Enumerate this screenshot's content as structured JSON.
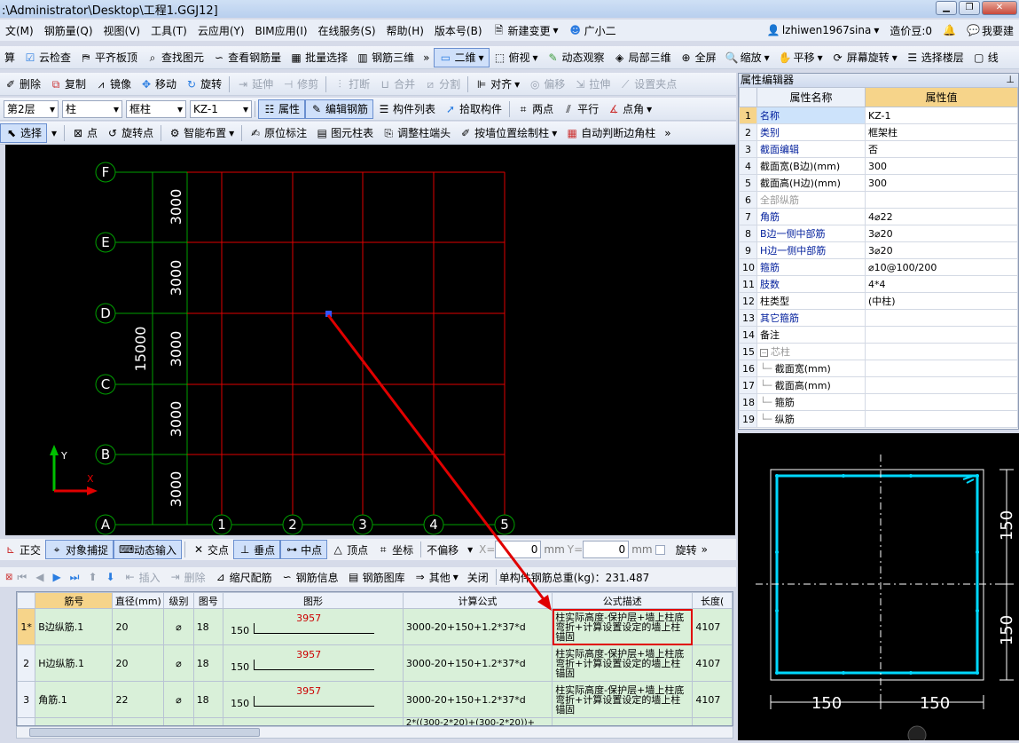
{
  "titlebar": {
    "title": ":\\Administrator\\Desktop\\工程1.GGJ12]"
  },
  "menu": [
    "文(M)",
    "钢筋量(Q)",
    "视图(V)",
    "工具(T)",
    "云应用(Y)",
    "BIM应用(I)",
    "在线服务(S)",
    "帮助(H)",
    "版本号(B)",
    "新建变更",
    "广小二"
  ],
  "account": {
    "user": "lzhiwen1967sina",
    "points": "造价豆:0",
    "help": "我要建"
  },
  "toolbar1": [
    "算",
    "云检查",
    "平齐板顶",
    "查找图元",
    "查看钢筋量",
    "批量选择",
    "钢筋三维",
    "二维",
    "俯视",
    "动态观察",
    "局部三维",
    "全屏",
    "缩放",
    "平移",
    "屏幕旋转",
    "选择楼层",
    "线"
  ],
  "toolbar2": [
    "删除",
    "复制",
    "镜像",
    "移动",
    "旋转",
    "延伸",
    "修剪",
    "打断",
    "合并",
    "分割",
    "对齐",
    "偏移",
    "拉伸",
    "设置夹点"
  ],
  "toolbar3": {
    "floor": "第2层",
    "category": "柱",
    "subcategory": "框柱",
    "component": "KZ-1",
    "buttons": [
      "属性",
      "编辑钢筋",
      "构件列表",
      "拾取构件",
      "两点",
      "平行",
      "点角"
    ]
  },
  "toolbar4": [
    "选择",
    "点",
    "旋转点",
    "智能布置",
    "原位标注",
    "图元柱表",
    "调整柱端头",
    "按墙位置绘制柱",
    "自动判断边角柱"
  ],
  "canvas": {
    "row_labels": [
      "F",
      "E",
      "D",
      "C",
      "B",
      "A"
    ],
    "col_labels": [
      "1",
      "2",
      "3",
      "4",
      "5"
    ],
    "dim_labels": [
      "3000",
      "3000",
      "3000",
      "3000",
      "3000"
    ],
    "total_dim": "15000",
    "axis_y": "Y",
    "axis_x": "X"
  },
  "statusbar": {
    "items": [
      "正交",
      "对象捕捉",
      "动态输入",
      "交点",
      "垂点",
      "中点",
      "顶点",
      "坐标",
      "不偏移"
    ],
    "x_label": "X=",
    "x_value": "0",
    "unit_x": "mm",
    "y_label": "Y=",
    "y_value": "0",
    "unit_y": "mm",
    "rotate": "旋转"
  },
  "rebarbar": {
    "items": [
      "插入",
      "删除",
      "缩尺配筋",
      "钢筋信息",
      "钢筋图库",
      "其他",
      "关闭"
    ],
    "total": "单构件钢筋总重(kg)：231.487"
  },
  "rebar_table": {
    "headers": [
      "",
      "筋号",
      "直径(mm)",
      "级别",
      "图号",
      "图形",
      "计算公式",
      "公式描述",
      "长度("
    ],
    "rows": [
      {
        "rn": "1*",
        "name": "B边纵筋.1",
        "dia": "20",
        "grade": "⌀",
        "fig": "18",
        "hook": "150",
        "len": "3957",
        "formula": "3000-20+150+1.2*37*d",
        "desc": "柱实际高度-保护层+墙上柱底弯折+计算设置设定的墙上柱锚固",
        "total": "4107"
      },
      {
        "rn": "2",
        "name": "H边纵筋.1",
        "dia": "20",
        "grade": "⌀",
        "fig": "18",
        "hook": "150",
        "len": "3957",
        "formula": "3000-20+150+1.2*37*d",
        "desc": "柱实际高度-保护层+墙上柱底弯折+计算设置设定的墙上柱锚固",
        "total": "4107"
      },
      {
        "rn": "3",
        "name": "角筋.1",
        "dia": "22",
        "grade": "⌀",
        "fig": "18",
        "hook": "150",
        "len": "3957",
        "formula": "3000-20+150+1.2*37*d",
        "desc": "柱实际高度-保护层+墙上柱底弯折+计算设置设定的墙上柱锚固",
        "total": "4107"
      }
    ],
    "partial_formula": "2*((300-2*20)+(300-2*20))+"
  },
  "property_panel": {
    "title": "属性编辑器",
    "col_name": "属性名称",
    "col_value": "属性值",
    "rows": [
      {
        "n": "1",
        "name": "名称",
        "value": "KZ-1",
        "style": "blue"
      },
      {
        "n": "2",
        "name": "类别",
        "value": "框架柱",
        "style": "blue"
      },
      {
        "n": "3",
        "name": "截面编辑",
        "value": "否",
        "style": "blue"
      },
      {
        "n": "4",
        "name": "截面宽(B边)(mm)",
        "value": "300",
        "style": ""
      },
      {
        "n": "5",
        "name": "截面高(H边)(mm)",
        "value": "300",
        "style": ""
      },
      {
        "n": "6",
        "name": "全部纵筋",
        "value": "",
        "style": "grey"
      },
      {
        "n": "7",
        "name": "角筋",
        "value": "4⌀22",
        "style": "blue"
      },
      {
        "n": "8",
        "name": "B边一侧中部筋",
        "value": "3⌀20",
        "style": "blue"
      },
      {
        "n": "9",
        "name": "H边一侧中部筋",
        "value": "3⌀20",
        "style": "blue"
      },
      {
        "n": "10",
        "name": "箍筋",
        "value": "⌀10@100/200",
        "style": "blue"
      },
      {
        "n": "11",
        "name": "肢数",
        "value": "4*4",
        "style": "blue"
      },
      {
        "n": "12",
        "name": "柱类型",
        "value": "(中柱)",
        "style": ""
      },
      {
        "n": "13",
        "name": "其它箍筋",
        "value": "",
        "style": "blue"
      },
      {
        "n": "14",
        "name": "备注",
        "value": "",
        "style": ""
      },
      {
        "n": "15",
        "name": "芯柱",
        "value": "",
        "style": "grey"
      },
      {
        "n": "16",
        "name": "截面宽(mm)",
        "value": "",
        "style": ""
      },
      {
        "n": "17",
        "name": "截面高(mm)",
        "value": "",
        "style": ""
      },
      {
        "n": "18",
        "name": "箍筋",
        "value": "",
        "style": ""
      },
      {
        "n": "19",
        "name": "纵筋",
        "value": "",
        "style": ""
      }
    ]
  },
  "preview": {
    "dims": [
      "150",
      "150",
      "150",
      "150"
    ]
  },
  "colors": {
    "grid_red": "#e00000",
    "grid_green": "#00a000",
    "highlight_red": "#e00000",
    "section_cyan": "#00d8ff"
  }
}
